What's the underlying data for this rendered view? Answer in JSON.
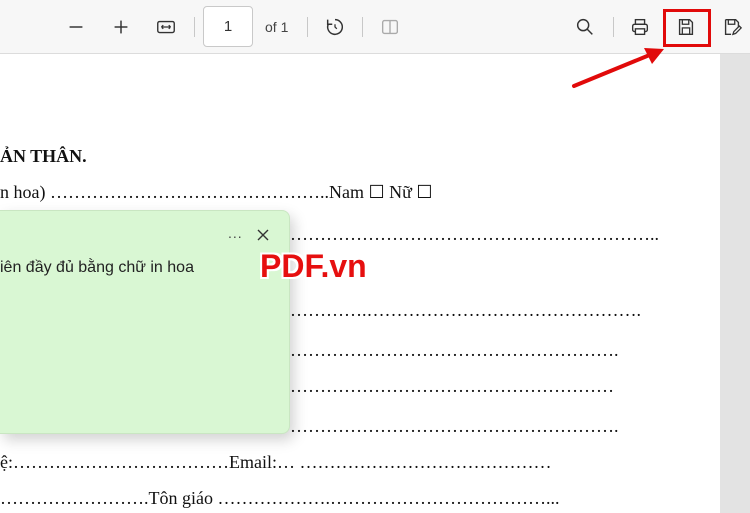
{
  "toolbar": {
    "zoom_out": "zoom-out",
    "zoom_in": "zoom-in",
    "fit_width": "fit-to-width",
    "page_number": "1",
    "page_total": "of 1",
    "rotate": "rotate",
    "page_view": "page-view",
    "search": "search",
    "print": "print",
    "save": "save",
    "save_as": "save-as"
  },
  "document": {
    "lines": [
      "ẢN THÂN.",
      "n hoa) ………………………………………..Nam   ☐              Nữ   ☐",
      "……………………………………………………..",
      "………….……………………………………….",
      "……………………………………………….",
      "………………………………………………",
      "……………………………………………….",
      "ệ:………………………………Email:… ……………………………………",
      "…………………….Tôn giáo ……………….………………………………..."
    ]
  },
  "comment": {
    "more": "...",
    "text": "iên đầy đủ bằng chữ in hoa"
  },
  "watermark": "PDF.vn",
  "colors": {
    "highlight": "#e10a0a",
    "comment_bg": "#d9f7d3",
    "toolbar_bg": "#f7f7f7"
  }
}
